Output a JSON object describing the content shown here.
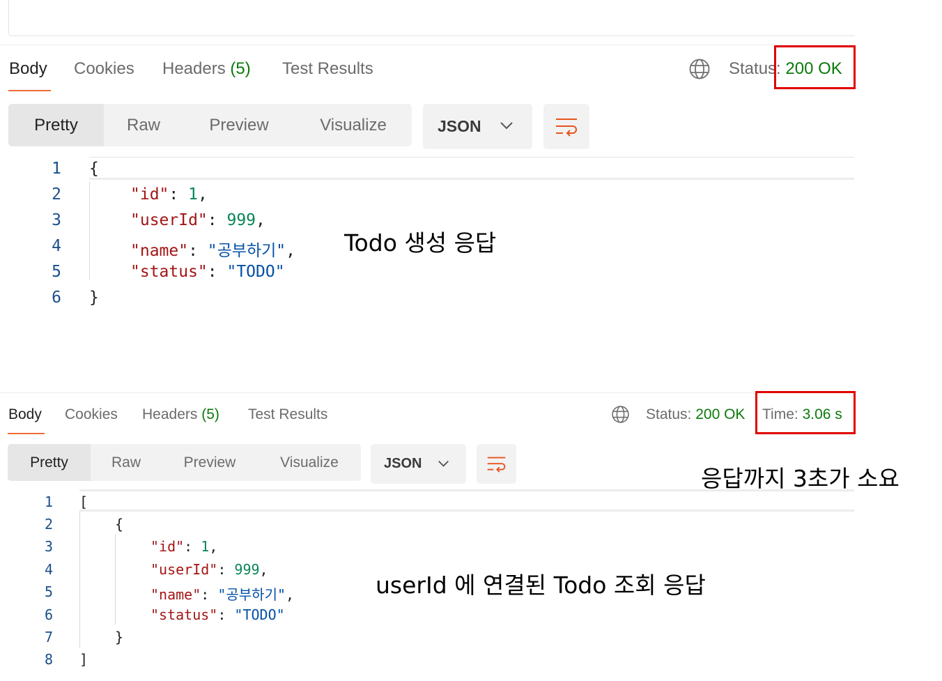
{
  "top": {
    "tabs": [
      {
        "label": "Body"
      },
      {
        "label": "Cookies"
      },
      {
        "label": "Headers",
        "count": "(5)"
      },
      {
        "label": "Test Results"
      }
    ],
    "status_label": "Status:",
    "status_value": "200 OK",
    "view_modes": [
      "Pretty",
      "Raw",
      "Preview",
      "Visualize"
    ],
    "format": "JSON",
    "line_numbers": [
      "1",
      "2",
      "3",
      "4",
      "5",
      "6"
    ],
    "json": {
      "open": "{",
      "close": "}",
      "id_key": "\"id\"",
      "id_val": "1",
      "userId_key": "\"userId\"",
      "userId_val": "999",
      "name_key": "\"name\"",
      "name_val": "\"공부하기\"",
      "status_key": "\"status\"",
      "status_val": "\"TODO\""
    },
    "annotation": "Todo 생성 응답"
  },
  "bottom": {
    "tabs": [
      {
        "label": "Body"
      },
      {
        "label": "Cookies"
      },
      {
        "label": "Headers",
        "count": "(5)"
      },
      {
        "label": "Test Results"
      }
    ],
    "status_label": "Status:",
    "status_value": "200 OK",
    "time_label": "Time:",
    "time_value": "3.06 s",
    "view_modes": [
      "Pretty",
      "Raw",
      "Preview",
      "Visualize"
    ],
    "format": "JSON",
    "line_numbers": [
      "1",
      "2",
      "3",
      "4",
      "5",
      "6",
      "7",
      "8"
    ],
    "json": {
      "arr_open": "[",
      "arr_close": "]",
      "obj_open": "{",
      "obj_close": "}",
      "id_key": "\"id\"",
      "id_val": "1",
      "userId_key": "\"userId\"",
      "userId_val": "999",
      "name_key": "\"name\"",
      "name_val": "\"공부하기\"",
      "status_key": "\"status\"",
      "status_val": "\"TODO\""
    },
    "annotation_time": "응답까지 3초가 소요",
    "annotation": "userId 에 연결된 Todo 조회 응답"
  },
  "colors": {
    "accent": "#f26b3a",
    "status_ok": "#0a7a0a",
    "highlight_box": "#e00000"
  }
}
